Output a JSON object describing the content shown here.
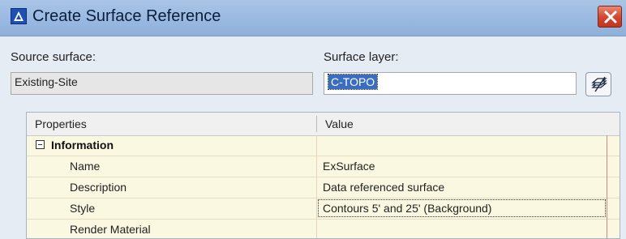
{
  "window": {
    "title": "Create Surface Reference",
    "close_icon": "close-icon"
  },
  "source_surface": {
    "label": "Source surface:",
    "value": "Existing-Site"
  },
  "surface_layer": {
    "label": "Surface layer:",
    "value": "C-TOPO",
    "button_icon": "layers-icon"
  },
  "grid": {
    "columns": [
      "Properties",
      "Value"
    ],
    "group": {
      "name": "Information",
      "expanded": true
    },
    "rows": [
      {
        "name": "Name",
        "value": "ExSurface"
      },
      {
        "name": "Description",
        "value": "Data referenced surface"
      },
      {
        "name": "Style",
        "value": "Contours 5' and 25' (Background)"
      },
      {
        "name": "Render Material",
        "value": ""
      }
    ]
  },
  "colors": {
    "titlebar": "#9dbbe2",
    "close_button": "#d2452e",
    "selection": "#3a6cbf",
    "grid_background": "#fbf8e2"
  }
}
